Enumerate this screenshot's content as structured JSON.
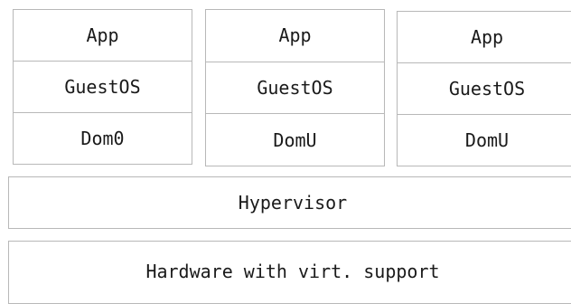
{
  "stacks": [
    {
      "app": "App",
      "guest_os": "GuestOS",
      "domain": "Dom0"
    },
    {
      "app": "App",
      "guest_os": "GuestOS",
      "domain": "DomU"
    },
    {
      "app": "App",
      "guest_os": "GuestOS",
      "domain": "DomU"
    }
  ],
  "hypervisor": "Hypervisor",
  "hardware": "Hardware with virt. support",
  "colors": {
    "border": "#b8b8b8",
    "text": "#1a1a1a",
    "background": "#ffffff"
  }
}
